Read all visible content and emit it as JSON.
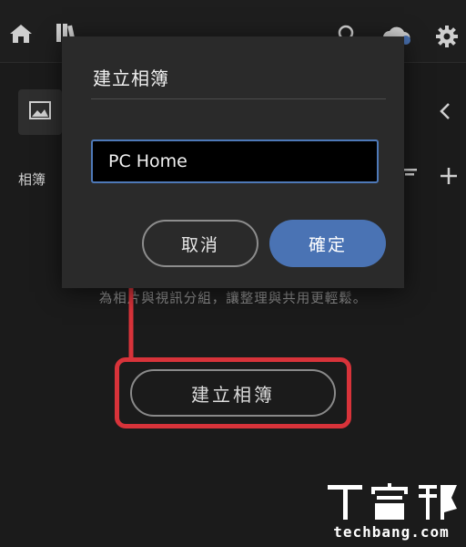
{
  "topbar": {
    "icons": [
      "home-icon",
      "library-icon",
      "search-icon",
      "cloud-icon",
      "gear-icon"
    ]
  },
  "sidebar": {
    "albums_label": "相簿"
  },
  "main": {
    "empty_text": "為相片與視訊分組，讓整理與共用更輕鬆。",
    "create_album_label": "建立相簿"
  },
  "dialog": {
    "title": "建立相簿",
    "input_value": "PC Home",
    "cancel_label": "取消",
    "confirm_label": "確定"
  },
  "annotation": {
    "color": "#d8333a"
  },
  "watermark": {
    "logo_text": "T客邦",
    "site_text": "techbang.com"
  },
  "colors": {
    "accent": "#4a73b4",
    "background": "#1b1b1b",
    "dialog": "#2a2a2a"
  }
}
